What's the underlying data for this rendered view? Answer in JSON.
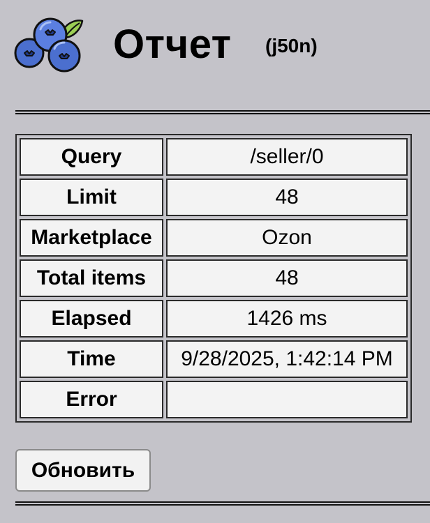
{
  "header": {
    "logo_icon": "blueberries-icon",
    "title": "Отчет",
    "subtitle": "(j50n)"
  },
  "report": {
    "rows": [
      {
        "key": "Query",
        "value": "/seller/0"
      },
      {
        "key": "Limit",
        "value": "48"
      },
      {
        "key": "Marketplace",
        "value": "Ozon"
      },
      {
        "key": "Total items",
        "value": "48"
      },
      {
        "key": "Elapsed",
        "value": "1426 ms"
      },
      {
        "key": "Time",
        "value": "9/28/2025, 1:42:14 PM"
      },
      {
        "key": "Error",
        "value": ""
      }
    ]
  },
  "actions": {
    "refresh_label": "Обновить"
  },
  "colors": {
    "background": "#c4c3c9",
    "cell_background": "#f3f3f3",
    "border": "#2a2a2a",
    "berry_blue": "#4b6fcf",
    "leaf_green": "#9ccf55"
  }
}
